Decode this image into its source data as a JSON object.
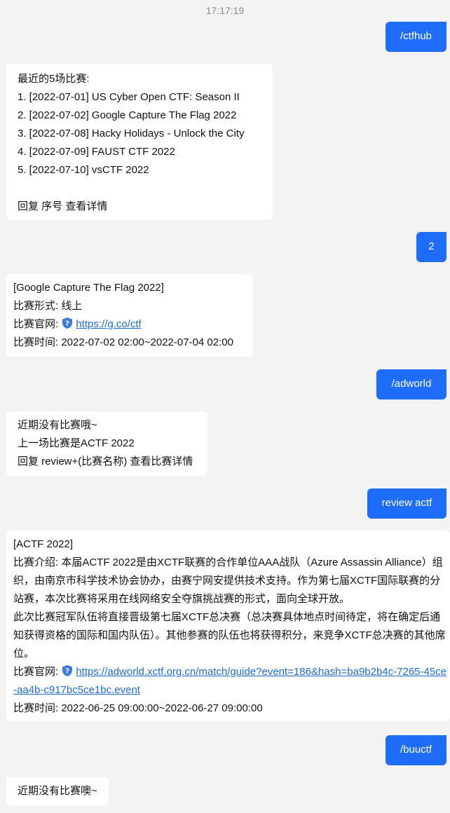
{
  "timestamp": "17:17:19",
  "colors": {
    "outgoing_bubble": "#1e6cfa",
    "incoming_bubble": "#ffffff",
    "background": "#f3f3f3",
    "link": "#1e6cd2"
  },
  "messages": {
    "m1": {
      "text": "/ctfhub"
    },
    "m2": {
      "header": "最近的5场比赛:",
      "items": [
        "1. [2022-07-01] US Cyber Open CTF: Season II",
        "2. [2022-07-02] Google Capture The Flag 2022",
        "3. [2022-07-08] Hacky Holidays - Unlock the City",
        "4. [2022-07-09] FAUST CTF 2022",
        "5. [2022-07-10] vsCTF 2022"
      ],
      "footer": "回复 序号 查看详情"
    },
    "m3": {
      "text": "2"
    },
    "m4": {
      "title": "[Google Capture The Flag 2022]",
      "format": "比赛形式: 线上",
      "site_label": "比赛官网:",
      "site_icon": "shield-icon",
      "site_url": "https://g.co/ctf",
      "time": "比赛时间: 2022-07-02 02:00~2022-07-04 02:00"
    },
    "m5": {
      "text": "/adworld"
    },
    "m6": {
      "line1": "近期没有比赛哦~",
      "line2": "上一场比赛是ACTF 2022",
      "line3": "回复 review+(比赛名称) 查看比赛详情"
    },
    "m7": {
      "text": "review actf"
    },
    "m8": {
      "title": "[ACTF 2022]",
      "intro": "比赛介绍: 本届ACTF 2022是由XCTF联赛的合作单位AAA战队（Azure Assassin Alliance）组织，由南京市科学技术协会协办，由赛宁网安提供技术支持。作为第七届XCTF国际联赛的分站赛，本次比赛将采用在线网络安全夺旗挑战赛的形式，面向全球开放。",
      "champion": "此次比赛冠军队伍将直接晋级第七届XCTF总决赛（总决赛具体地点时间待定，将在确定后通知获得资格的国际和国内队伍）。其他参赛的队伍也将获得积分，来竞争XCTF总决赛的其他席位。",
      "site_label": "比赛官网:",
      "site_icon": "shield-icon",
      "site_url": "https://adworld.xctf.org.cn/match/guide?event=186&hash=ba9b2b4c-7265-45ce-aa4b-c917bc5ce1bc.event",
      "time": "比赛时间: 2022-06-25 09:00:00~2022-06-27 09:00:00"
    },
    "m9": {
      "text": "/buuctf"
    },
    "m10": {
      "text": "近期没有比赛噢~"
    }
  }
}
